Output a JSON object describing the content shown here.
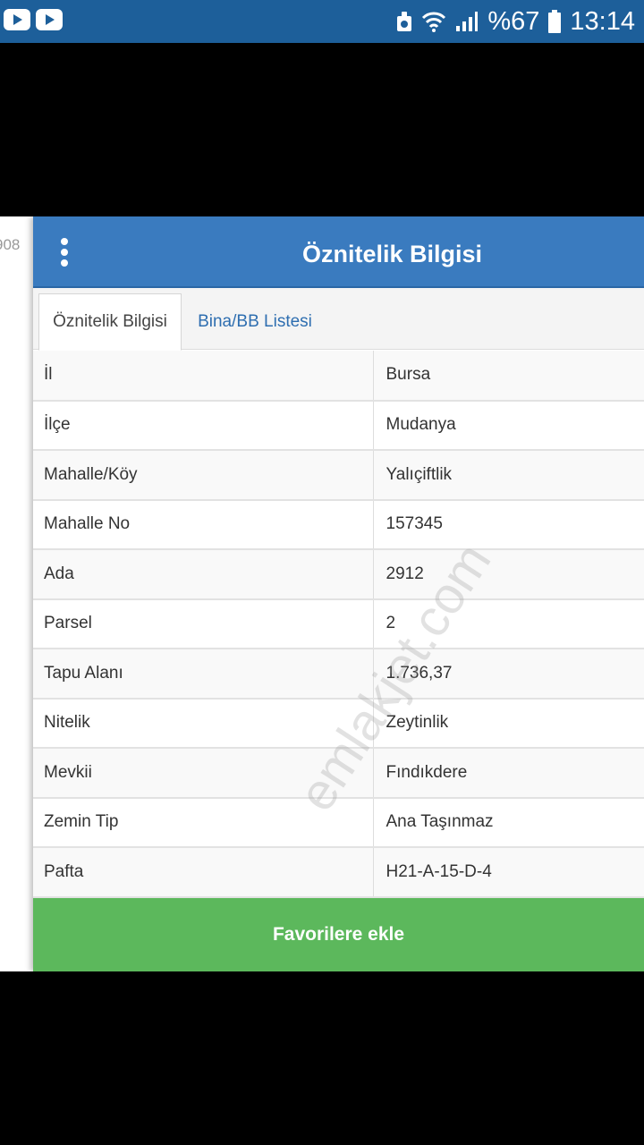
{
  "status_bar": {
    "battery": "%67",
    "time": "13:14",
    "icons": [
      "youtube-icon",
      "youtube-icon",
      "security-icon",
      "wifi-icon",
      "signal-icon",
      "battery-icon"
    ]
  },
  "page_edge_text": "908",
  "header": {
    "title": "Öznitelik Bilgisi",
    "menu_icon": "vertical-dots-icon"
  },
  "tabs": [
    {
      "label": "Öznitelik Bilgisi",
      "active": true
    },
    {
      "label": "Bina/BB Listesi",
      "active": false
    }
  ],
  "attributes": [
    {
      "key": "İl",
      "value": "Bursa"
    },
    {
      "key": "İlçe",
      "value": "Mudanya"
    },
    {
      "key": "Mahalle/Köy",
      "value": "Yalıçiftlik"
    },
    {
      "key": "Mahalle No",
      "value": "157345"
    },
    {
      "key": "Ada",
      "value": "2912"
    },
    {
      "key": "Parsel",
      "value": "2"
    },
    {
      "key": "Tapu Alanı",
      "value": "1.736,37"
    },
    {
      "key": "Nitelik",
      "value": "Zeytinlik"
    },
    {
      "key": "Mevkii",
      "value": "Fındıkdere"
    },
    {
      "key": "Zemin Tip",
      "value": "Ana Taşınmaz"
    },
    {
      "key": "Pafta",
      "value": "H21-A-15-D-4"
    }
  ],
  "favorite_button": {
    "label": "Favorilere ekle"
  },
  "watermark": "emlakjet.com",
  "colors": {
    "status_bar": "#1d5f9a",
    "header": "#3a7bbf",
    "tab_link": "#2e6eb0",
    "favorite_button": "#5cb85c"
  }
}
